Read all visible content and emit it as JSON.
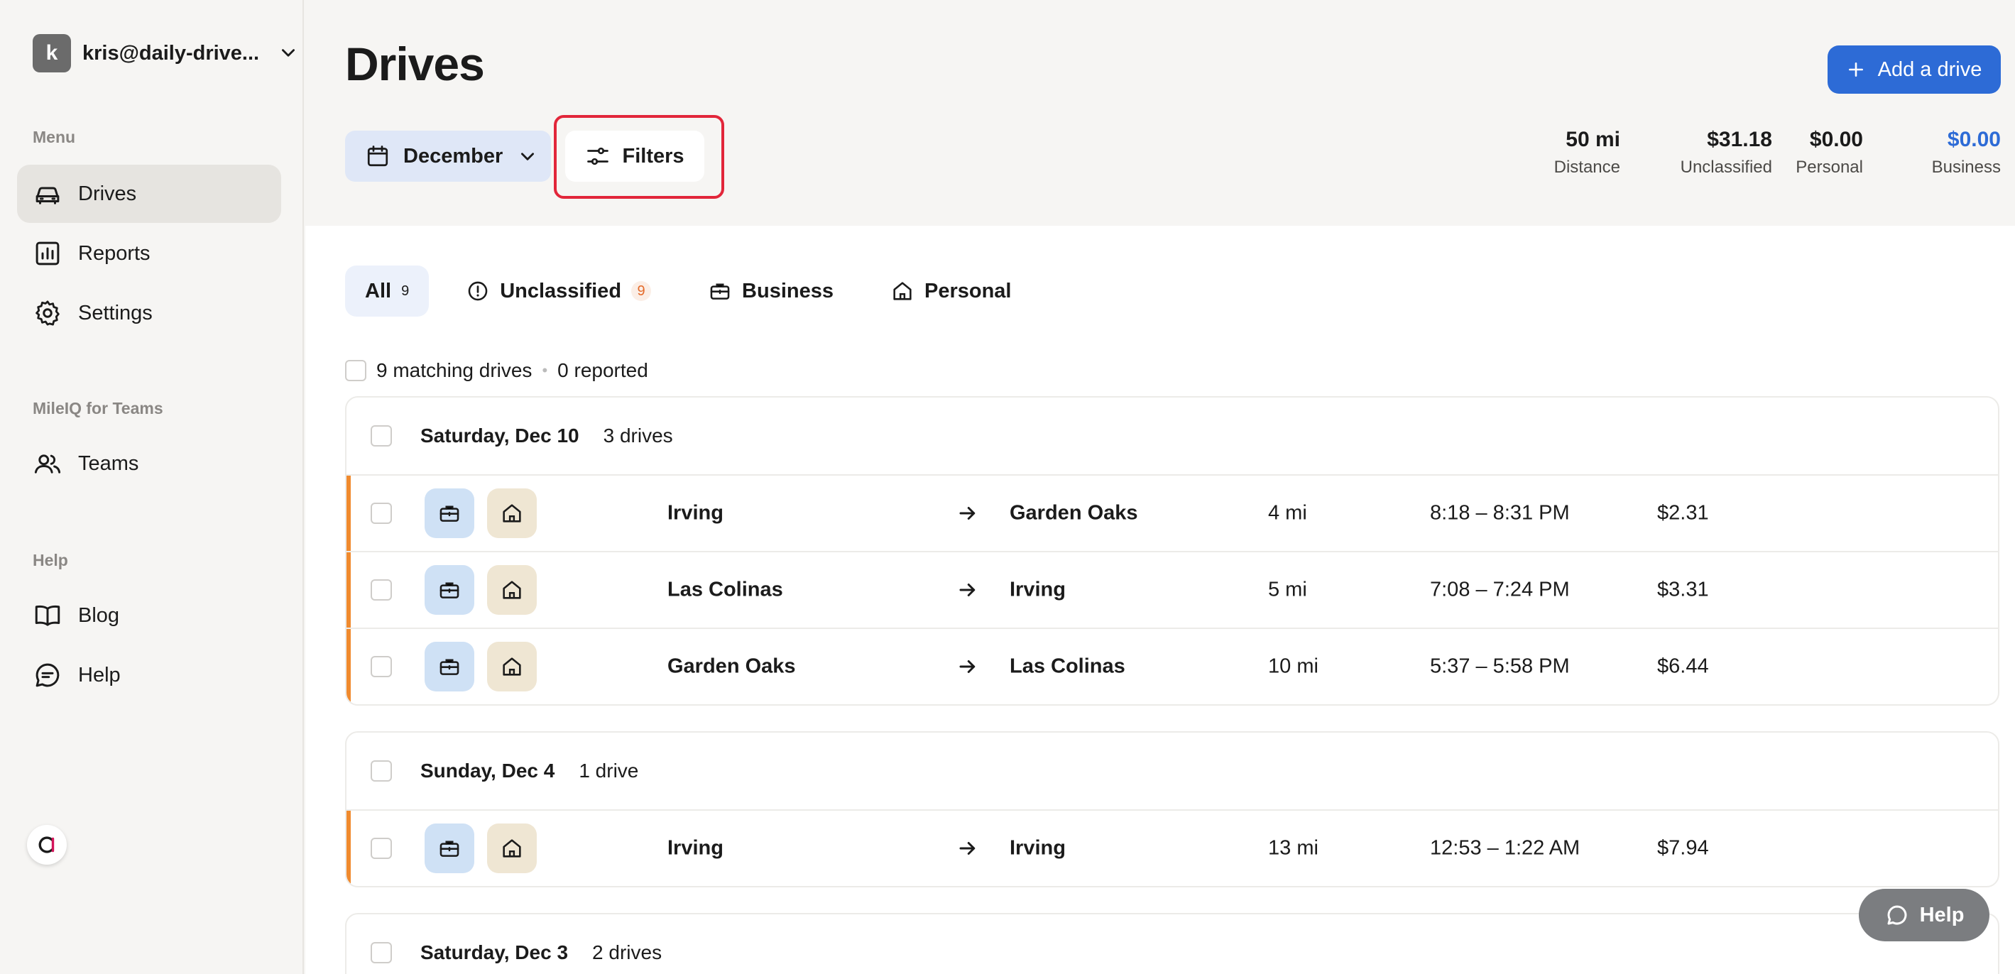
{
  "account": {
    "initial": "k",
    "email": "kris@daily-drive..."
  },
  "sidebar": {
    "menu_label": "Menu",
    "menu": [
      {
        "label": "Drives",
        "icon": "car-icon",
        "active": true
      },
      {
        "label": "Reports",
        "icon": "reports-icon"
      },
      {
        "label": "Settings",
        "icon": "gear-icon"
      }
    ],
    "teams_label": "MileIQ for Teams",
    "teams": [
      {
        "label": "Teams",
        "icon": "teams-icon"
      }
    ],
    "help_label": "Help",
    "help": [
      {
        "label": "Blog",
        "icon": "book-icon"
      },
      {
        "label": "Help",
        "icon": "chat-icon"
      }
    ]
  },
  "header": {
    "title": "Drives",
    "add_drive": "Add a drive",
    "month": "December",
    "filters": "Filters",
    "stats": [
      {
        "value": "50 mi",
        "label": "Distance"
      },
      {
        "value": "$31.18",
        "label": "Unclassified"
      },
      {
        "value": "$0.00",
        "label": "Personal"
      },
      {
        "value": "$0.00",
        "label": "Business"
      }
    ]
  },
  "tabs": [
    {
      "label": "All",
      "count": "9",
      "active": true
    },
    {
      "label": "Unclassified",
      "count": "9"
    },
    {
      "label": "Business"
    },
    {
      "label": "Personal"
    }
  ],
  "summary": {
    "matching": "9 matching drives",
    "reported": "0 reported"
  },
  "groups": [
    {
      "date": "Saturday, Dec 10",
      "count": "3 drives",
      "drives": [
        {
          "from": "Irving",
          "to": "Garden Oaks",
          "distance": "4 mi",
          "time": "8:18 – 8:31 PM",
          "amount": "$2.31"
        },
        {
          "from": "Las Colinas",
          "to": "Irving",
          "distance": "5 mi",
          "time": "7:08 – 7:24 PM",
          "amount": "$3.31"
        },
        {
          "from": "Garden Oaks",
          "to": "Las Colinas",
          "distance": "10 mi",
          "time": "5:37 – 5:58 PM",
          "amount": "$6.44"
        }
      ]
    },
    {
      "date": "Sunday, Dec 4",
      "count": "1 drive",
      "drives": [
        {
          "from": "Irving",
          "to": "Irving",
          "distance": "13 mi",
          "time": "12:53 – 1:22 AM",
          "amount": "$7.94"
        }
      ]
    },
    {
      "date": "Saturday, Dec 3",
      "count": "2 drives",
      "drives": []
    }
  ],
  "help_fab": "Help",
  "colors": {
    "accent": "#2d6bd6",
    "highlight": "#e2263a",
    "unclassified_bar": "#f08a2e"
  }
}
